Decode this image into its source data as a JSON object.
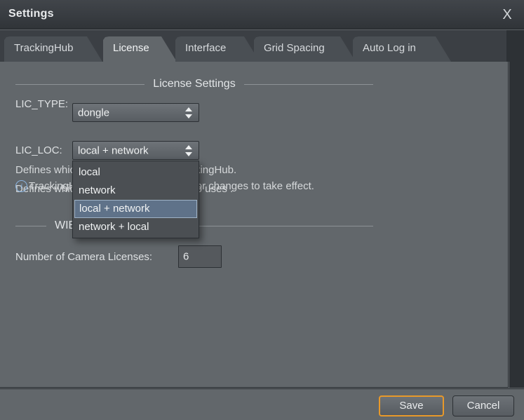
{
  "window": {
    "title": "Settings",
    "close_label": "X"
  },
  "tabs": [
    {
      "label": "TrackingHub",
      "active": false
    },
    {
      "label": "License",
      "active": true
    },
    {
      "label": "Interface",
      "active": false
    },
    {
      "label": "Grid Spacing",
      "active": false
    },
    {
      "label": "Auto Log in",
      "active": false
    }
  ],
  "license_group": {
    "header": "License Settings",
    "lic_type": {
      "label": "LIC_TYPE:",
      "value": "dongle",
      "description": "Defines which Licensetype TrackingHub uses ."
    },
    "lic_loc": {
      "label": "LIC_LOC:",
      "value": "local + network",
      "description": "Defines which location is used for TrackingHub.",
      "options": [
        "local",
        "network",
        "local + network",
        "network + local"
      ],
      "selected_option": "local + network"
    },
    "info_note": "TrackingHub needs to be restarted for changes to take effect."
  },
  "wibu_group": {
    "header": "WIBU",
    "camera_licenses": {
      "label": "Number of Camera Licenses:",
      "value": "6"
    }
  },
  "footer": {
    "save_label": "Save",
    "cancel_label": "Cancel"
  },
  "colors": {
    "panel_bg": "#62676b",
    "titlebar_bg": "#393d41",
    "tab_inactive": "#4a4f54",
    "accent_focus": "#e8992a",
    "selection": "#5f7289",
    "info_blue": "#8ab4e0"
  }
}
